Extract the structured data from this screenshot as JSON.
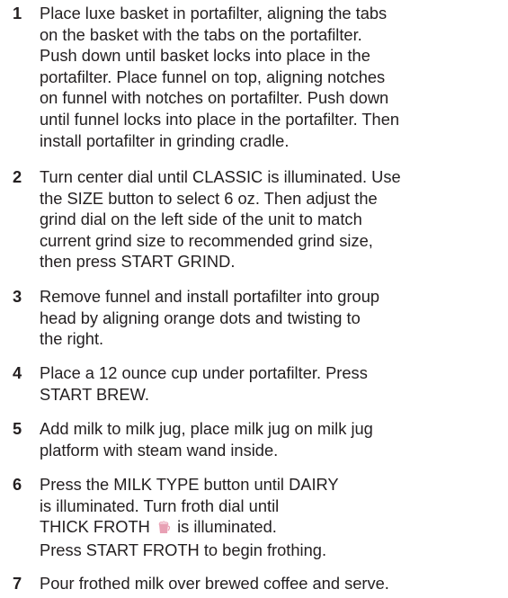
{
  "steps": [
    {
      "number": "1",
      "lines": [
        "Place luxe basket in portafilter, aligning the tabs",
        "on the basket with the tabs on the portafilter.",
        "Push down until basket locks into place in the",
        "portafilter. Place funnel on top, aligning notches",
        "on funnel with notches on portafilter. Push down",
        "until funnel locks into place in the portafilter. Then",
        "install portafilter in grinding cradle."
      ]
    },
    {
      "number": "2",
      "lines": [
        "Turn center dial until CLASSIC is illuminated. Use",
        "the SIZE button to select 6 oz. Then adjust the",
        "grind dial on the left side of the unit to match",
        "current grind size to recommended grind size,",
        "then press START GRIND."
      ]
    },
    {
      "number": "3",
      "lines": [
        "Remove funnel and install portafilter into group",
        "head by aligning orange dots and twisting to",
        "the right."
      ]
    },
    {
      "number": "4",
      "lines": [
        "Place a 12 ounce cup under portafilter. Press",
        "START BREW."
      ]
    },
    {
      "number": "5",
      "lines": [
        "Add milk to milk jug, place milk jug on milk jug",
        "platform with steam wand inside."
      ]
    },
    {
      "number": "6",
      "line1": "Press the MILK TYPE button until DAIRY",
      "line2": "is illuminated. Turn froth dial until",
      "line3_before": "THICK FROTH",
      "line3_after": "is illuminated.",
      "line4": "Press START FROTH to begin frothing.",
      "icon": "thick-froth-icon"
    },
    {
      "number": "7",
      "lines": [
        "Pour frothed milk over brewed coffee and serve."
      ]
    }
  ],
  "colors": {
    "text": "#231f20",
    "icon_fill": "#e8a0b4",
    "icon_foam": "#f7d9e3"
  }
}
